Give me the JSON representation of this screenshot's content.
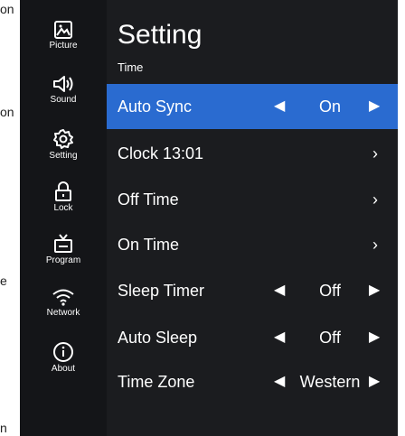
{
  "edge_texts": [
    "on",
    "on",
    "e",
    "n"
  ],
  "sidebar": {
    "items": [
      {
        "label": "Picture",
        "icon": "picture-icon"
      },
      {
        "label": "Sound",
        "icon": "speaker-icon"
      },
      {
        "label": "Setting",
        "icon": "gear-icon"
      },
      {
        "label": "Lock",
        "icon": "lock-icon"
      },
      {
        "label": "Program",
        "icon": "tv-icon"
      },
      {
        "label": "Network",
        "icon": "wifi-icon"
      },
      {
        "label": "About",
        "icon": "info-icon"
      }
    ]
  },
  "main": {
    "title": "Setting",
    "subtitle": "Time",
    "rows": [
      {
        "label": "Auto Sync",
        "value": "On",
        "type": "toggle",
        "active": true
      },
      {
        "label": "Clock 13:01",
        "type": "submenu"
      },
      {
        "label": "Off Time",
        "type": "submenu"
      },
      {
        "label": "On Time",
        "type": "submenu"
      },
      {
        "label": "Sleep Timer",
        "value": "Off",
        "type": "toggle"
      },
      {
        "label": "Auto Sleep",
        "value": "Off",
        "type": "toggle"
      },
      {
        "label": "Time Zone",
        "value": "Western",
        "type": "toggle"
      }
    ],
    "arrow_left": "◀",
    "arrow_right": "▶",
    "chevron": "›"
  },
  "colors": {
    "background": "#1b1c1f",
    "sidebar": "#141518",
    "highlight": "#2a6bd0",
    "text": "#ffffff"
  }
}
